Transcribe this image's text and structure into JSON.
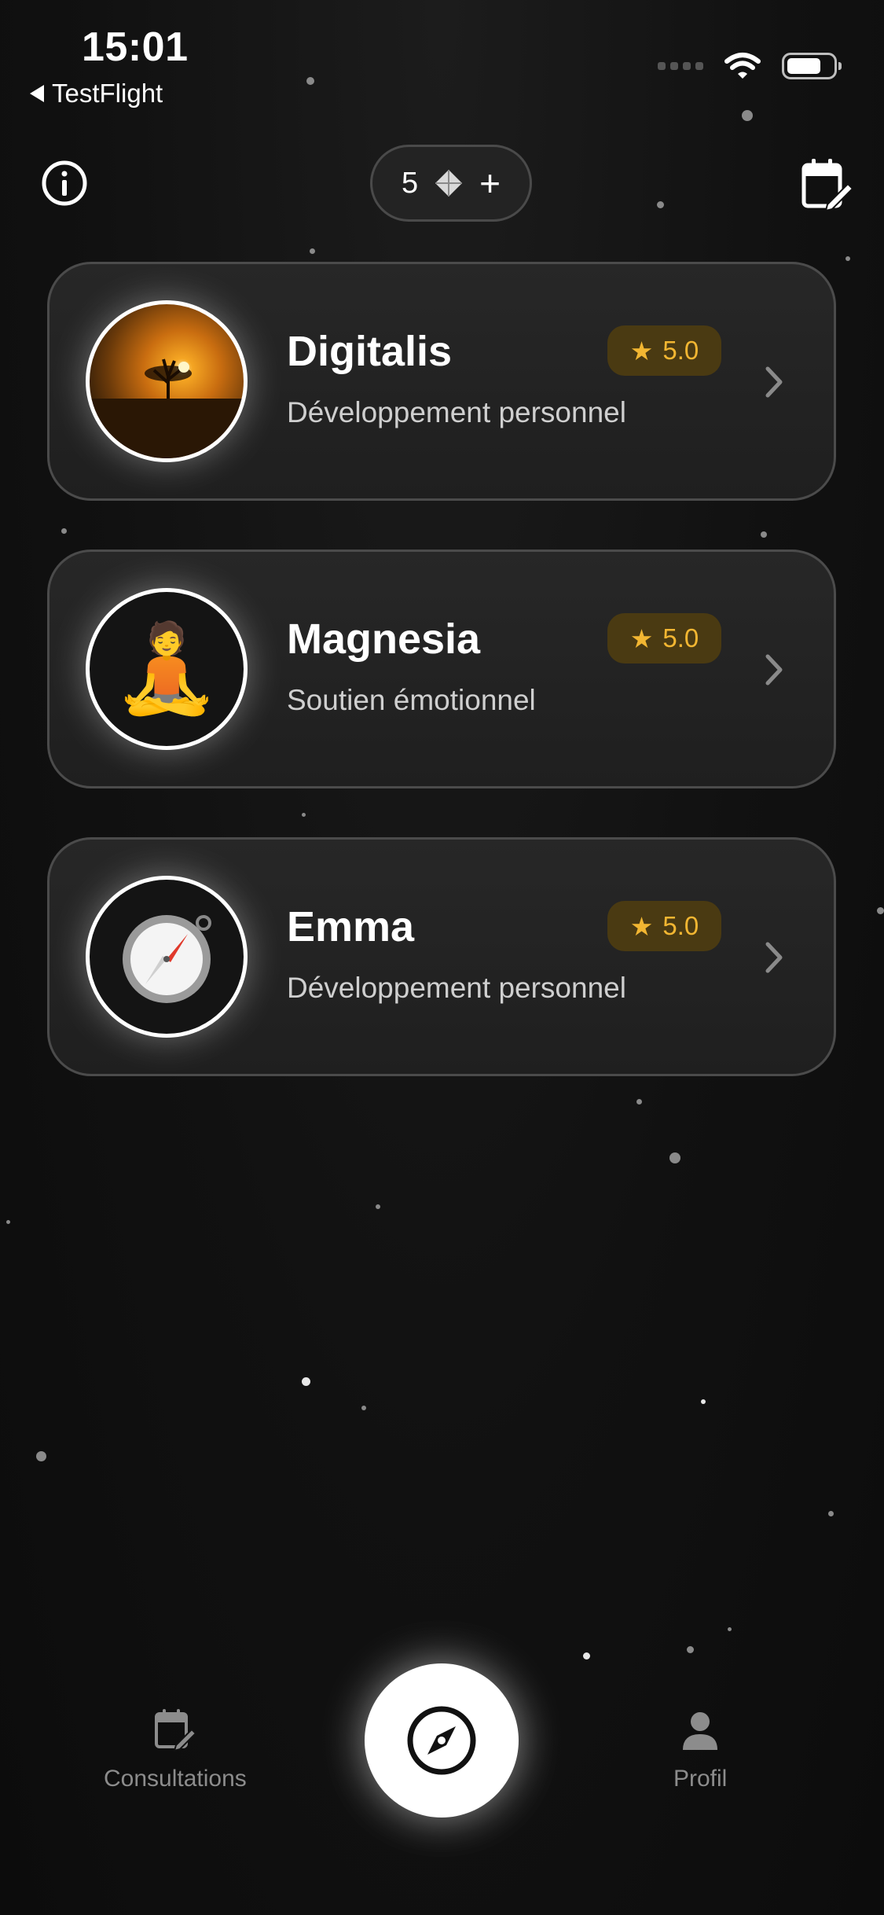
{
  "status_bar": {
    "time": "15:01",
    "back_app": "TestFlight"
  },
  "top_bar": {
    "credits": "5"
  },
  "practitioners": [
    {
      "name": "Digitalis",
      "specialty": "Développement personnel",
      "rating": "5.0",
      "avatar": "sunset-photo"
    },
    {
      "name": "Magnesia",
      "specialty": "Soutien émotionnel",
      "rating": "5.0",
      "avatar": "meditation-emoji",
      "avatar_glyph": "🧘"
    },
    {
      "name": "Emma",
      "specialty": "Développement personnel",
      "rating": "5.0",
      "avatar": "compass-emoji"
    }
  ],
  "bottom_nav": {
    "consultations": "Consultations",
    "profil": "Profil"
  },
  "colors": {
    "background": "#111111",
    "rating_bg": "#4a3a12",
    "rating_text": "#f2b632"
  }
}
